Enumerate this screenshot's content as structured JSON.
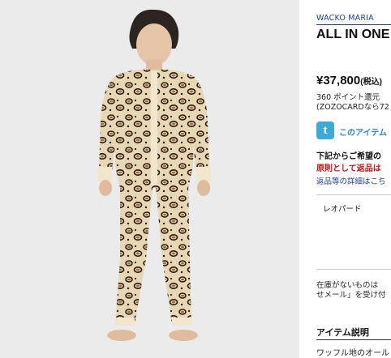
{
  "product": {
    "brand": "WACKO MARIA",
    "title": "ALL IN ONE",
    "price": "¥37,800",
    "tax_note": "(税込)",
    "points": "360 ポイント還元",
    "zozocard": "(ZOZOCARDなら72",
    "image_alt": "leopard-print one-piece"
  },
  "social": {
    "icon_letter": "t",
    "share_text": "このアイテム"
  },
  "notices": {
    "select_prompt": "下記からご希望の",
    "return_warning": "原則として返品は",
    "return_link": "返品等の詳細はこち"
  },
  "options": {
    "color": "レオパード"
  },
  "stock": {
    "line1": "在庫がないものは",
    "line2": "せメール」を受け付"
  },
  "description": {
    "heading": "アイテム説明",
    "text": "ワッフル地のオール"
  },
  "colors": {
    "brand_blue": "#1a3c9b",
    "warning_red": "#cc1111",
    "twitter_blue": "#3fa9d6",
    "photo_bg": "#ebebeb"
  }
}
